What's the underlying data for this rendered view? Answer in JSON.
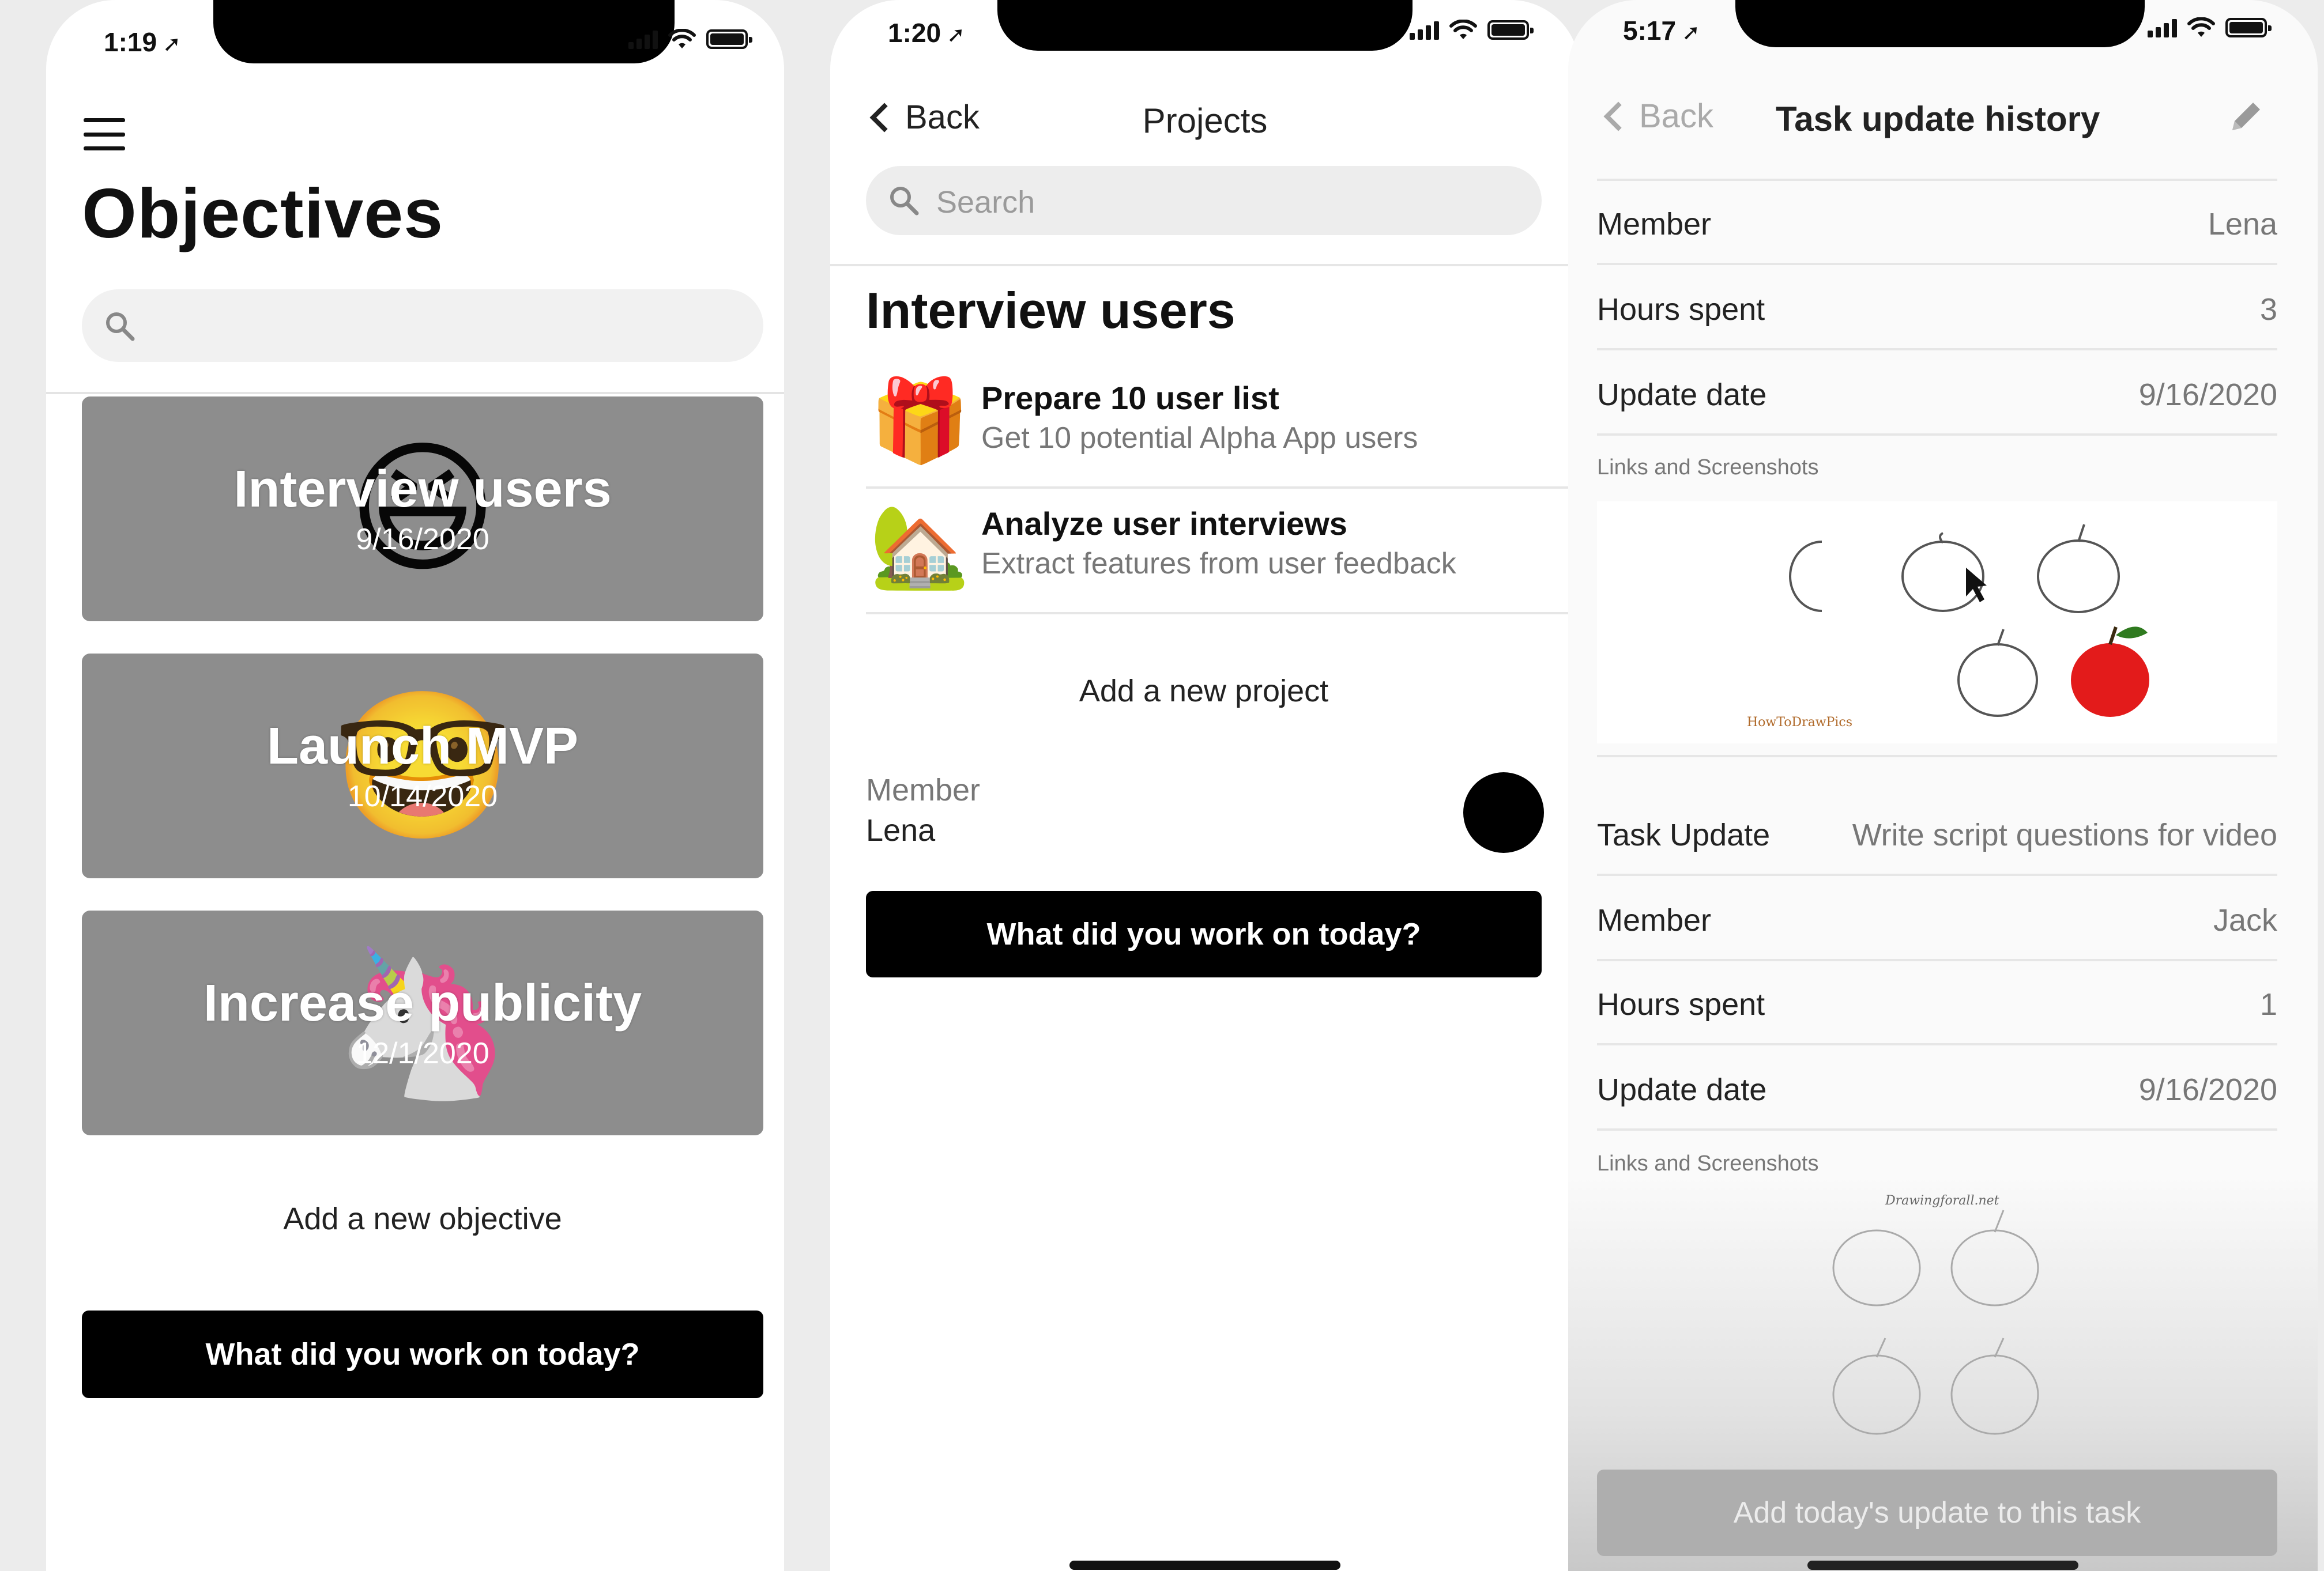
{
  "screen1": {
    "status": {
      "time": "1:19"
    },
    "title": "Objectives",
    "objectives": [
      {
        "title": "Interview users",
        "date": "9/16/2020",
        "emoji": "😆"
      },
      {
        "title": "Launch MVP",
        "date": "10/14/2020",
        "emoji": "🤓"
      },
      {
        "title": "Increase publicity",
        "date": "12/1/2020",
        "emoji": "🦄"
      }
    ],
    "add_label": "Add a new objective",
    "cta_label": "What did you work on today?"
  },
  "screen2": {
    "status": {
      "time": "1:20"
    },
    "back_label": "Back",
    "nav_title": "Projects",
    "search_placeholder": "Search",
    "section_title": "Interview users",
    "projects": [
      {
        "name": "Prepare 10 user list",
        "description": "Get 10 potential Alpha App users",
        "emoji": "🎁"
      },
      {
        "name": "Analyze user interviews",
        "description": "Extract features from user feedback",
        "emoji": "🏡"
      }
    ],
    "add_label": "Add a new project",
    "member_label": "Member",
    "member_value": "Lena",
    "cta_label": "What did you work on today?"
  },
  "screen3": {
    "status": {
      "time": "5:17"
    },
    "back_label": "Back",
    "nav_title": "Task update history",
    "entry1": {
      "member_label": "Member",
      "member_value": "Lena",
      "hours_label": "Hours spent",
      "hours_value": "3",
      "date_label": "Update date",
      "date_value": "9/16/2020",
      "links_label": "Links and Screenshots",
      "shot_caption": "HowToDrawPics"
    },
    "entry2": {
      "task_label": "Task Update",
      "task_value": "Write script questions for video",
      "member_label": "Member",
      "member_value": "Jack",
      "hours_label": "Hours spent",
      "hours_value": "1",
      "date_label": "Update date",
      "date_value": "9/16/2020",
      "links_label": "Links and Screenshots",
      "shot_caption": "Drawingforall.net"
    },
    "cta_label": "Add today's update to this task"
  },
  "colors": {
    "card_gray": "#8d8d8d",
    "button_black": "#000000",
    "apple_red": "#e31b1b",
    "leaf_green": "#2f7a1f"
  }
}
